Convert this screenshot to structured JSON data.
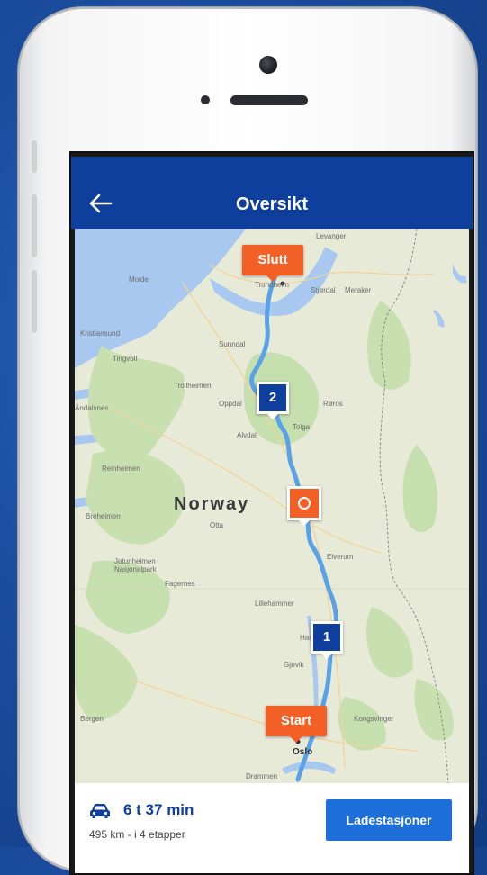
{
  "appbar": {
    "title": "Oversikt"
  },
  "map": {
    "country": "Norway",
    "places": [
      "Trondheim",
      "Oslo",
      "Lillehammer",
      "Gjøvik",
      "Otta",
      "Oppdal",
      "Molde",
      "Tolga",
      "Røros",
      "Drammen",
      "Kongsvinger",
      "Bergen",
      "Levanger",
      "Meraker",
      "Stjørdal",
      "Kristiansund",
      "Tingvoll",
      "Sunndal",
      "Trollheimen",
      "Reinheimen",
      "Breheimen",
      "Jotunheimen Nasjonalpark",
      "Åndalsnes",
      "Alvdal",
      "Elverum",
      "Hamar",
      "Fagernes"
    ],
    "markers": {
      "end": "Slutt",
      "start": "Start",
      "stop1": "1",
      "stop2": "2"
    },
    "colors": {
      "route": "#5aa2e8",
      "marker_orange": "#f26026",
      "marker_blue": "#0f3f9c"
    }
  },
  "trip": {
    "duration": "6 t 37 min",
    "summary": "495 km - i 4 etapper"
  },
  "actions": {
    "charging_stations": "Ladestasjoner"
  },
  "icons": {
    "back": "arrow-left-icon",
    "car": "car-icon",
    "station": "charging-station-icon"
  }
}
